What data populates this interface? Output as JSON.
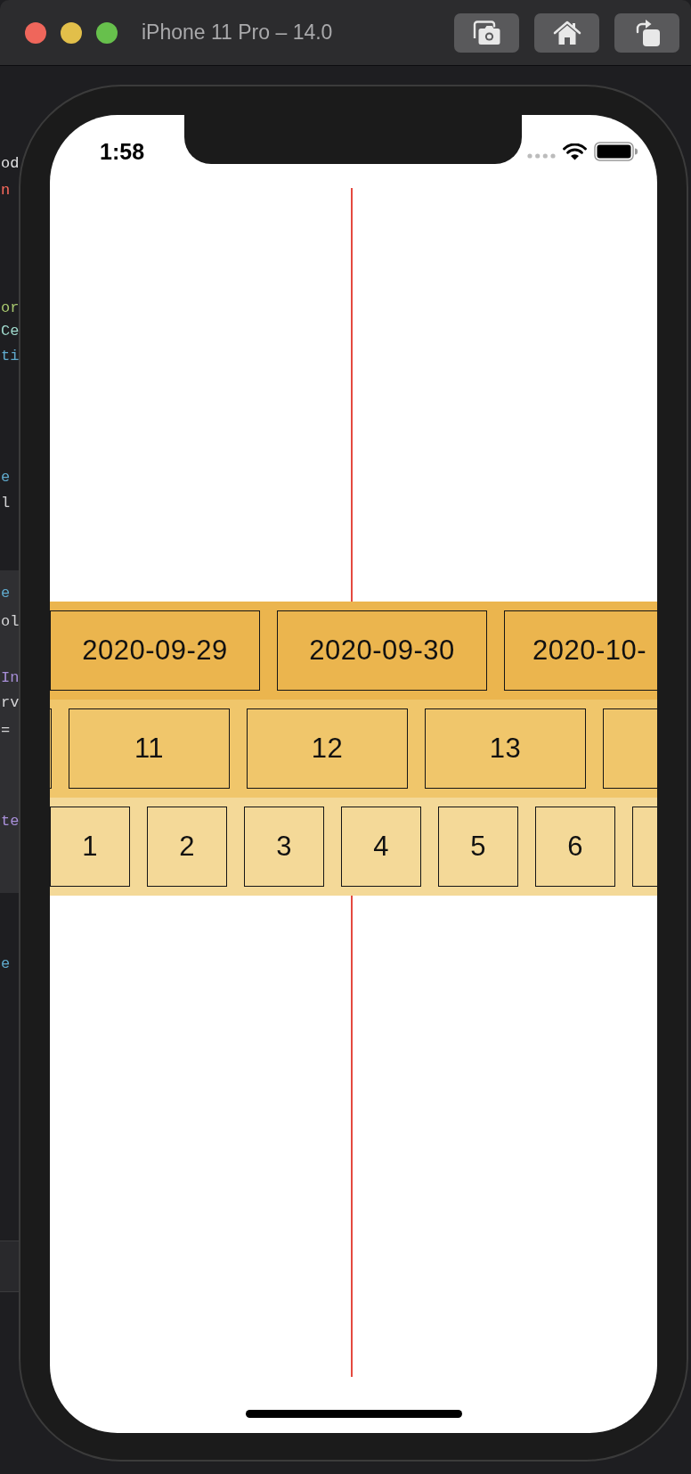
{
  "window": {
    "title": "iPhone 11 Pro – 14.0"
  },
  "editor_fragments": [
    {
      "text": "od",
      "color": "#e2e2e4"
    },
    {
      "text": "n",
      "color": "#fc6a5d"
    },
    {
      "text": "or",
      "color": "#a7c76e"
    },
    {
      "text": "Ce",
      "color": "#9fd9cc"
    },
    {
      "text": "ti",
      "color": "#5fa9cc"
    },
    {
      "text": "e",
      "color": "#5fa9cc"
    },
    {
      "text": "l",
      "color": "#d4d4d6"
    },
    {
      "text": "e",
      "color": "#5fa9cc"
    },
    {
      "text": "ol",
      "color": "#d4d4d6"
    },
    {
      "text": "In",
      "color": "#a88fd9"
    },
    {
      "text": "rv",
      "color": "#d4d4d6"
    },
    {
      "text": "=",
      "color": "#d4d4d6"
    },
    {
      "text": "te",
      "color": "#a88fd9"
    },
    {
      "text": "e",
      "color": "#5fa9cc"
    }
  ],
  "status_bar": {
    "time": "1:58"
  },
  "strips": [
    {
      "color": "#ebb54e",
      "cells": [
        {
          "kind": "full",
          "label": "2020-09-29"
        },
        {
          "kind": "full",
          "label": "2020-09-30"
        },
        {
          "kind": "cut",
          "label": "2020-10-"
        }
      ]
    },
    {
      "color": "#f0c66b",
      "cells": [
        {
          "kind": "cut"
        },
        {
          "kind": "full",
          "label": "11"
        },
        {
          "kind": "full",
          "label": "12"
        },
        {
          "kind": "full",
          "label": "13"
        },
        {
          "kind": "cut"
        }
      ]
    },
    {
      "color": "#f4d998",
      "cells": [
        {
          "kind": "full",
          "label": "1"
        },
        {
          "kind": "full",
          "label": "2"
        },
        {
          "kind": "full",
          "label": "3"
        },
        {
          "kind": "full",
          "label": "4"
        },
        {
          "kind": "full",
          "label": "5"
        },
        {
          "kind": "full",
          "label": "6"
        },
        {
          "kind": "cut"
        }
      ]
    }
  ]
}
